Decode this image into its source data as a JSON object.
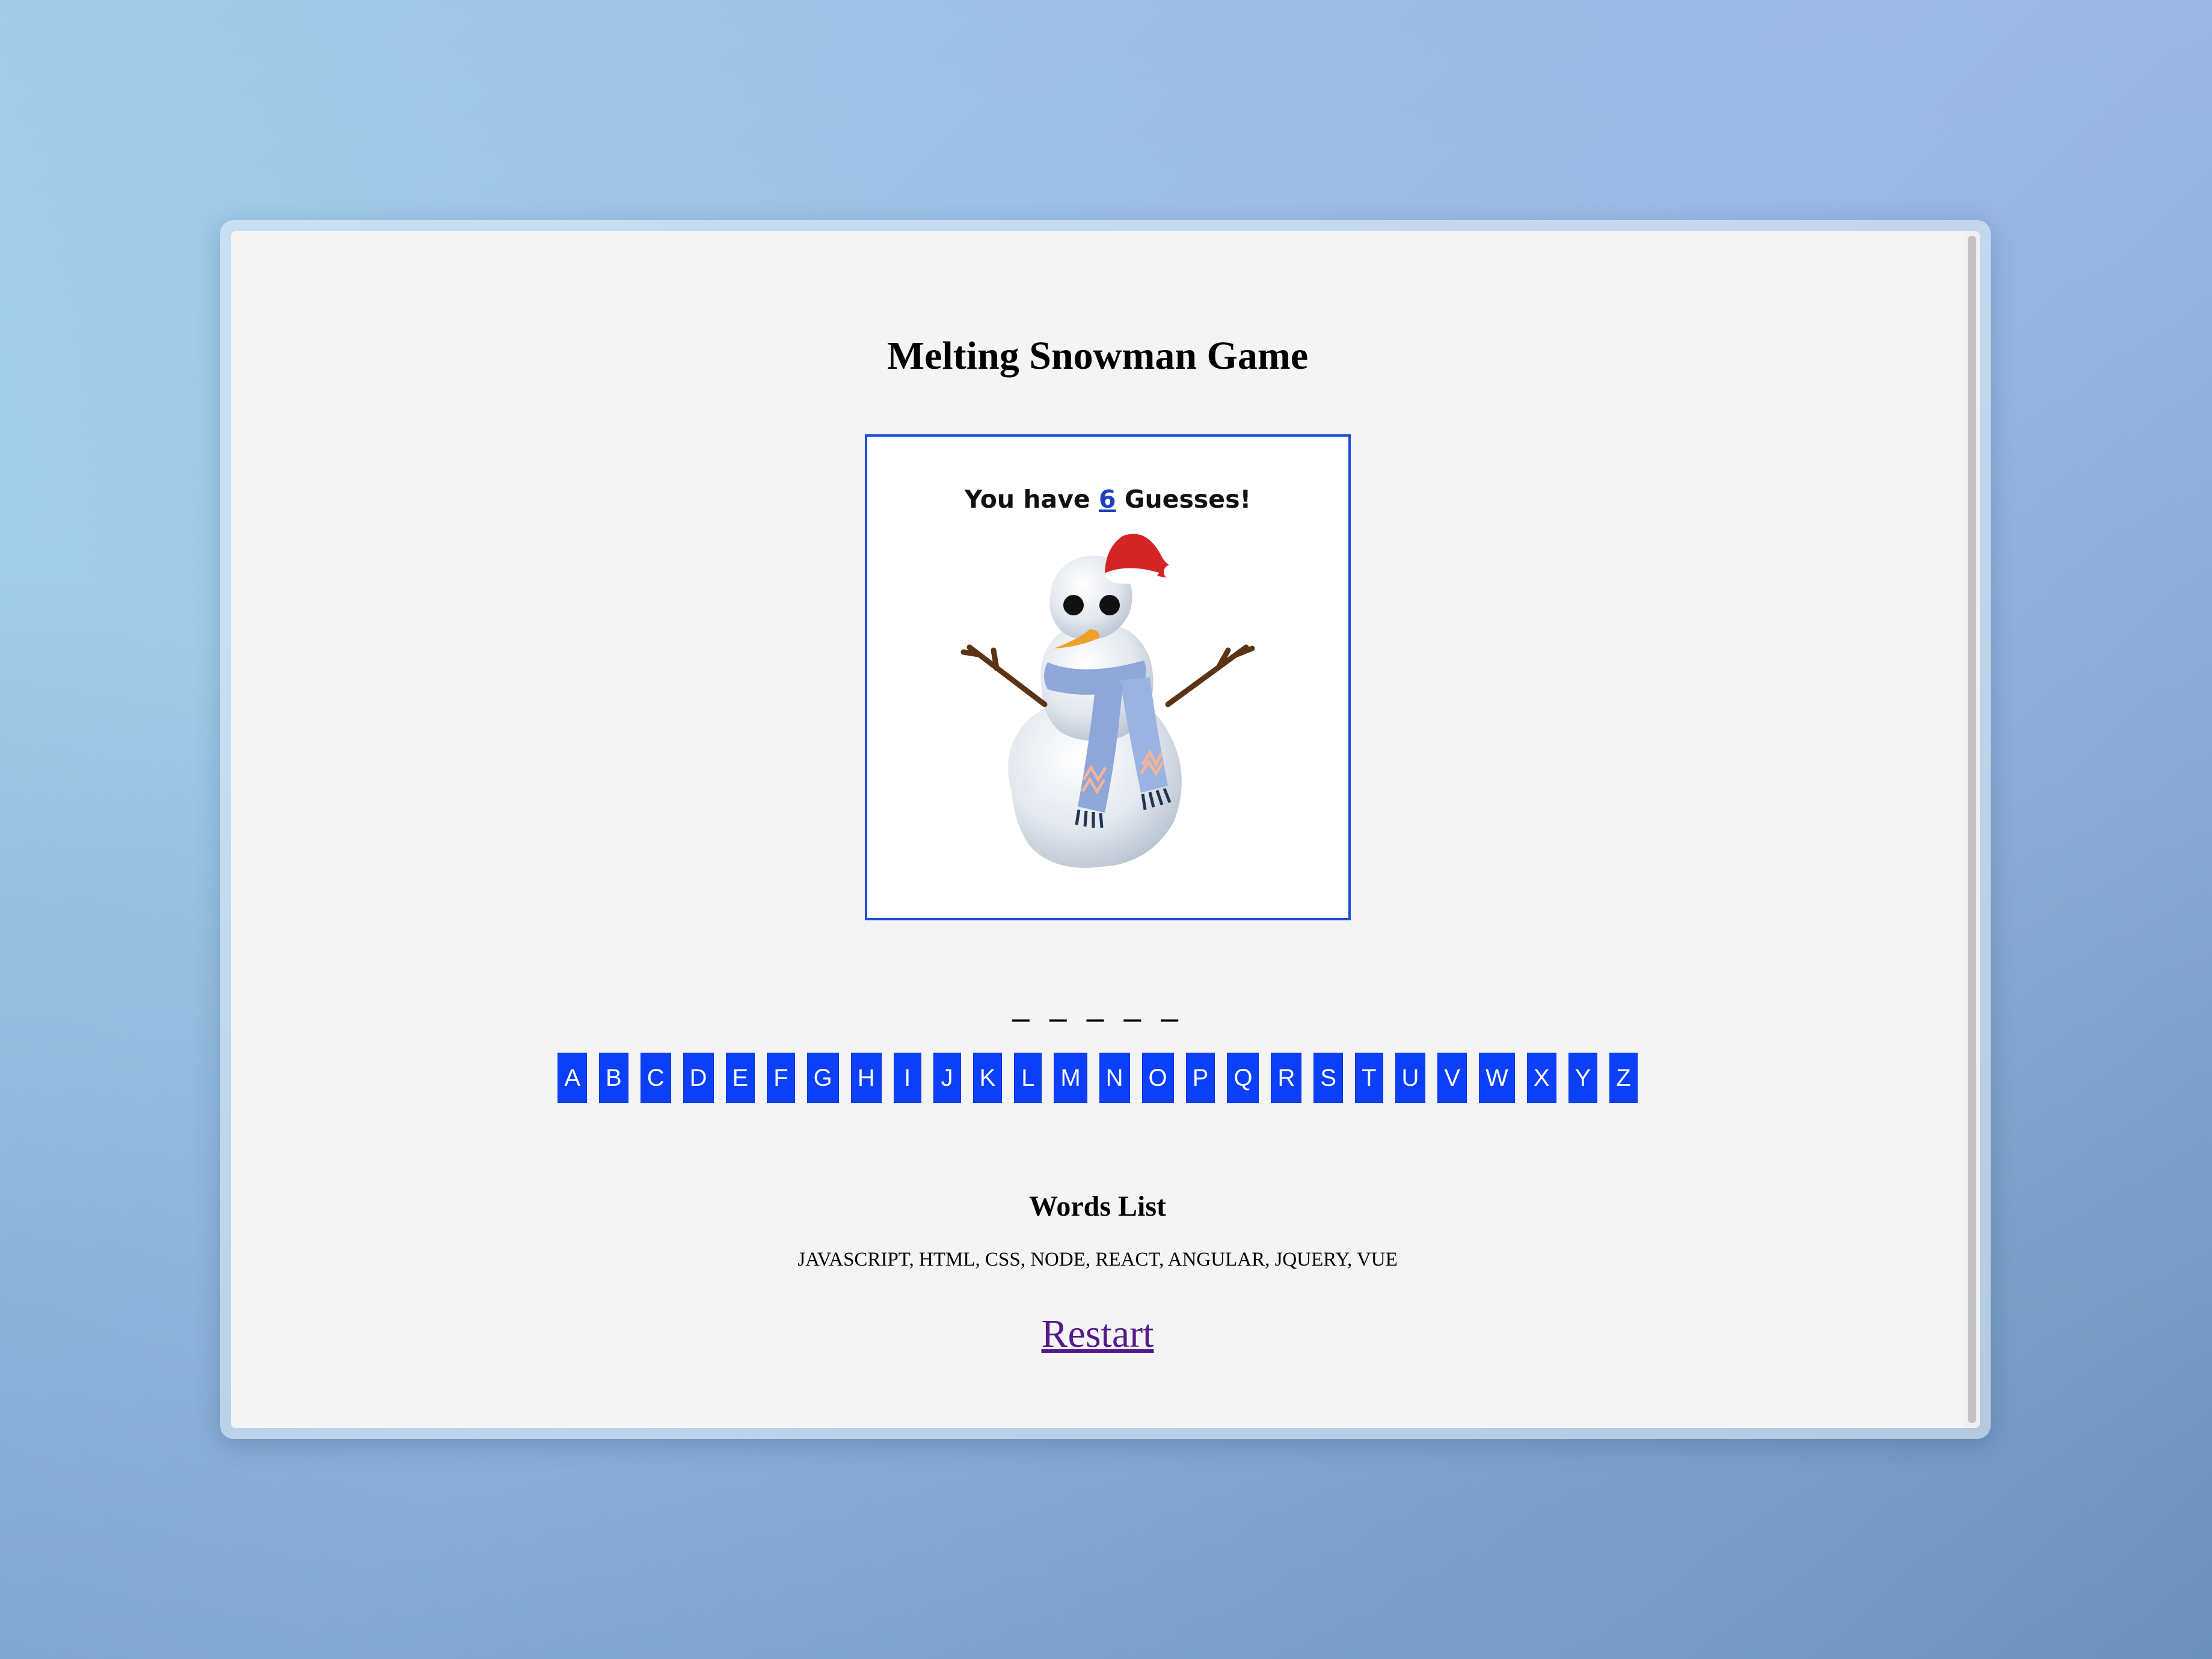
{
  "page": {
    "title": "Melting Snowman Game"
  },
  "game": {
    "guesses_prefix": "You have ",
    "guesses_count": "6",
    "guesses_suffix": " Guesses!",
    "word_blanks": "_ _ _ _ _",
    "image": "snowman-with-santa-hat-and-scarf"
  },
  "letters": [
    "A",
    "B",
    "C",
    "D",
    "E",
    "F",
    "G",
    "H",
    "I",
    "J",
    "K",
    "L",
    "M",
    "N",
    "O",
    "P",
    "Q",
    "R",
    "S",
    "T",
    "U",
    "V",
    "W",
    "X",
    "Y",
    "Z"
  ],
  "words": {
    "heading": "Words List",
    "list": "JAVASCRIPT, HTML, CSS, NODE, REACT, ANGULAR, JQUERY, VUE"
  },
  "actions": {
    "restart_label": "Restart"
  },
  "colors": {
    "accent": "#0b3ffa",
    "box_border": "#1d4ed8",
    "link": "#551a8b"
  }
}
